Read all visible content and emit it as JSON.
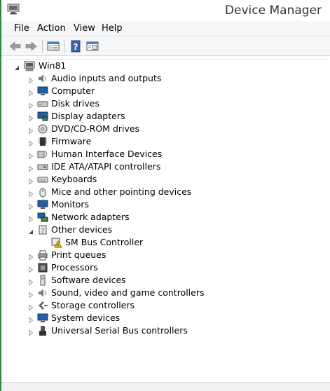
{
  "window": {
    "title": "Device Manager"
  },
  "menu": [
    "File",
    "Action",
    "View",
    "Help"
  ],
  "tree": {
    "root": "Win81",
    "categories": [
      {
        "label": "Audio inputs and outputs",
        "icon": "speaker-icon"
      },
      {
        "label": "Computer",
        "icon": "computer-icon"
      },
      {
        "label": "Disk drives",
        "icon": "disk-drive-icon"
      },
      {
        "label": "Display adapters",
        "icon": "display-adapter-icon"
      },
      {
        "label": "DVD/CD-ROM drives",
        "icon": "dvd-drive-icon"
      },
      {
        "label": "Firmware",
        "icon": "firmware-chip-icon"
      },
      {
        "label": "Human Interface Devices",
        "icon": "hid-icon"
      },
      {
        "label": "IDE ATA/ATAPI controllers",
        "icon": "ide-controller-icon"
      },
      {
        "label": "Keyboards",
        "icon": "keyboard-icon"
      },
      {
        "label": "Mice and other pointing devices",
        "icon": "mouse-icon"
      },
      {
        "label": "Monitors",
        "icon": "monitor-icon"
      },
      {
        "label": "Network adapters",
        "icon": "network-adapter-icon"
      },
      {
        "label": "Other devices",
        "icon": "other-devices-icon",
        "expanded": true,
        "children": [
          {
            "label": "SM Bus Controller",
            "icon": "warning-device-icon"
          }
        ]
      },
      {
        "label": "Print queues",
        "icon": "printer-icon"
      },
      {
        "label": "Processors",
        "icon": "processor-icon"
      },
      {
        "label": "Software devices",
        "icon": "software-device-icon"
      },
      {
        "label": "Sound, video and game controllers",
        "icon": "sound-icon"
      },
      {
        "label": "Storage controllers",
        "icon": "storage-controller-icon"
      },
      {
        "label": "System devices",
        "icon": "system-devices-icon"
      },
      {
        "label": "Universal Serial Bus controllers",
        "icon": "usb-icon"
      }
    ]
  }
}
